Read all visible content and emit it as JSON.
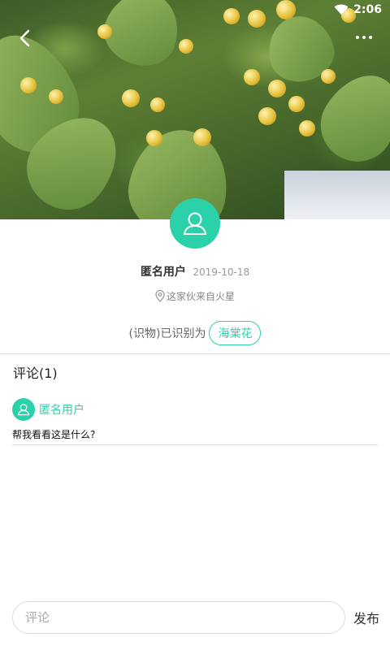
{
  "status_bar": {
    "time": "2:06"
  },
  "post": {
    "author": "匿名用户",
    "date": "2019-10-18",
    "location": "这家伙来自火星",
    "identified_prefix": "(识物)已识别为",
    "identified_name": "海棠花"
  },
  "comments": {
    "title": "评论(1)",
    "items": [
      {
        "user": "匿名用户",
        "text": "帮我看看这是什么?"
      }
    ]
  },
  "composer": {
    "placeholder": "评论",
    "publish_label": "发布"
  },
  "colors": {
    "accent": "#2bd1a9"
  },
  "icons": [
    "back-arrow-icon",
    "more-dots-icon",
    "wifi-icon",
    "user-avatar-icon",
    "location-pin-icon"
  ]
}
